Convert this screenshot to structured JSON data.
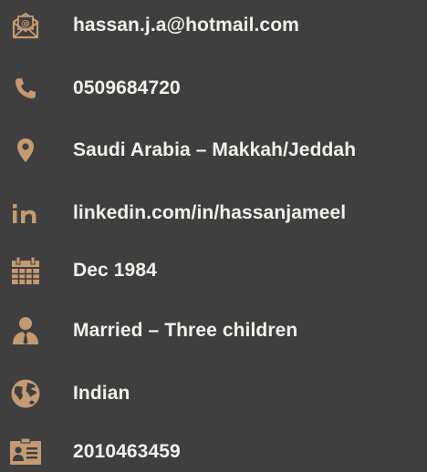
{
  "accent_color": "#c49a72",
  "background_color": "#3f3f3f",
  "text_color": "#f4f1ec",
  "items": [
    {
      "icon": "envelope-at-icon",
      "text": "hassan.j.a@hotmail.com"
    },
    {
      "icon": "phone-icon",
      "text": "0509684720"
    },
    {
      "icon": "location-pin-icon",
      "text": "Saudi Arabia – Makkah/Jeddah"
    },
    {
      "icon": "linkedin-icon",
      "text": "linkedin.com/in/hassanjameel"
    },
    {
      "icon": "calendar-icon",
      "text": "Dec 1984"
    },
    {
      "icon": "person-tie-icon",
      "text": "Married – Three children"
    },
    {
      "icon": "globe-icon",
      "text": "Indian"
    },
    {
      "icon": "id-card-icon",
      "text": "2010463459"
    }
  ]
}
